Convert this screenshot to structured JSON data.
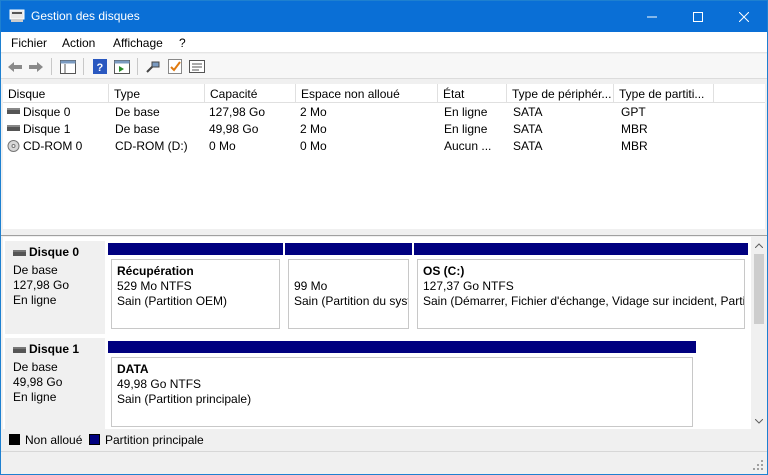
{
  "window": {
    "title": "Gestion des disques"
  },
  "menu": {
    "items": [
      "Fichier",
      "Action",
      "Affichage",
      "?"
    ]
  },
  "toolbar": {
    "icons": [
      "back-arrow-icon",
      "forward-arrow-icon",
      "console-tree-icon",
      "help-icon",
      "export-icon",
      "connect-icon",
      "properties-check-icon",
      "properties-icon"
    ]
  },
  "volumes_list": {
    "columns": [
      "Disque",
      "Type",
      "Capacité",
      "Espace non alloué",
      "État",
      "Type de périphér...",
      "Type de partiti..."
    ],
    "rows": [
      {
        "disk": "Disque 0",
        "type": "De base",
        "capacity": "127,98 Go",
        "unallocated": "2 Mo",
        "state": "En ligne",
        "device": "SATA",
        "partition_type": "GPT"
      },
      {
        "disk": "Disque 1",
        "type": "De base",
        "capacity": "49,98 Go",
        "unallocated": "2 Mo",
        "state": "En ligne",
        "device": "SATA",
        "partition_type": "MBR"
      },
      {
        "disk": "CD-ROM 0",
        "type": "CD-ROM (D:)",
        "capacity": "0 Mo",
        "unallocated": "0 Mo",
        "state": "Aucun ...",
        "device": "SATA",
        "partition_type": "MBR"
      }
    ]
  },
  "disks": [
    {
      "name": "Disque 0",
      "type": "De base",
      "size": "127,98 Go",
      "status": "En ligne",
      "partitions": [
        {
          "name": "Récupération",
          "size": "529 Mo NTFS",
          "status": "Sain (Partition OEM)"
        },
        {
          "name": "",
          "size": "99 Mo",
          "status": "Sain (Partition du syst"
        },
        {
          "name": "OS  (C:)",
          "size": "127,37 Go NTFS",
          "status": "Sain (Démarrer, Fichier d'échange, Vidage sur incident, Partiti"
        }
      ]
    },
    {
      "name": "Disque 1",
      "type": "De base",
      "size": "49,98 Go",
      "status": "En ligne",
      "partitions": [
        {
          "name": "DATA",
          "size": "49,98 Go NTFS",
          "status": "Sain (Partition principale)"
        }
      ]
    }
  ],
  "legend": [
    {
      "label": "Non alloué",
      "color": "#000000"
    },
    {
      "label": "Partition principale",
      "color": "#00007f"
    }
  ],
  "colors": {
    "titlebar": "#0a6fd6",
    "partition_bar": "#00007f"
  }
}
